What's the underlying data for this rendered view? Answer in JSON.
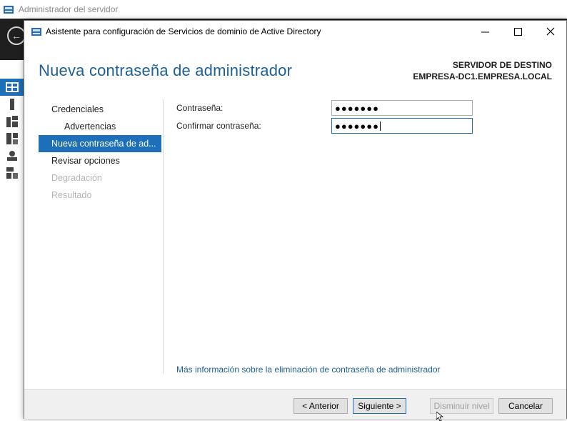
{
  "background_app": {
    "title": "Administrador del servidor"
  },
  "dialog": {
    "title": "Asistente para configuración de Servicios de dominio de Active Directory",
    "controls": {
      "minimize": "─",
      "maximize": "☐",
      "close": "✕"
    },
    "page_title": "Nueva contraseña de administrador",
    "destination": {
      "label": "SERVIDOR DE DESTINO",
      "server": "EMPRESA-DC1.EMPRESA.LOCAL"
    },
    "nav": [
      {
        "label": "Credenciales",
        "state": "normal"
      },
      {
        "label": "Advertencias",
        "state": "sub"
      },
      {
        "label": "Nueva contraseña de ad...",
        "state": "active"
      },
      {
        "label": "Revisar opciones",
        "state": "normal"
      },
      {
        "label": "Degradación",
        "state": "disabled"
      },
      {
        "label": "Resultado",
        "state": "disabled"
      }
    ],
    "form": {
      "password_label": "Contraseña:",
      "password_value": "●●●●●●●",
      "confirm_label": "Confirmar contraseña:",
      "confirm_value": "●●●●●●●"
    },
    "more_info_link": "Más información sobre la eliminación de contraseña de administrador",
    "buttons": {
      "previous": "< Anterior",
      "next": "Siguiente >",
      "lower_level": "Disminuir nivel",
      "cancel": "Cancelar"
    }
  },
  "colors": {
    "accent": "#1c6fb8",
    "title_blue": "#1c5f99",
    "header_dark": "#1f1f1f"
  }
}
